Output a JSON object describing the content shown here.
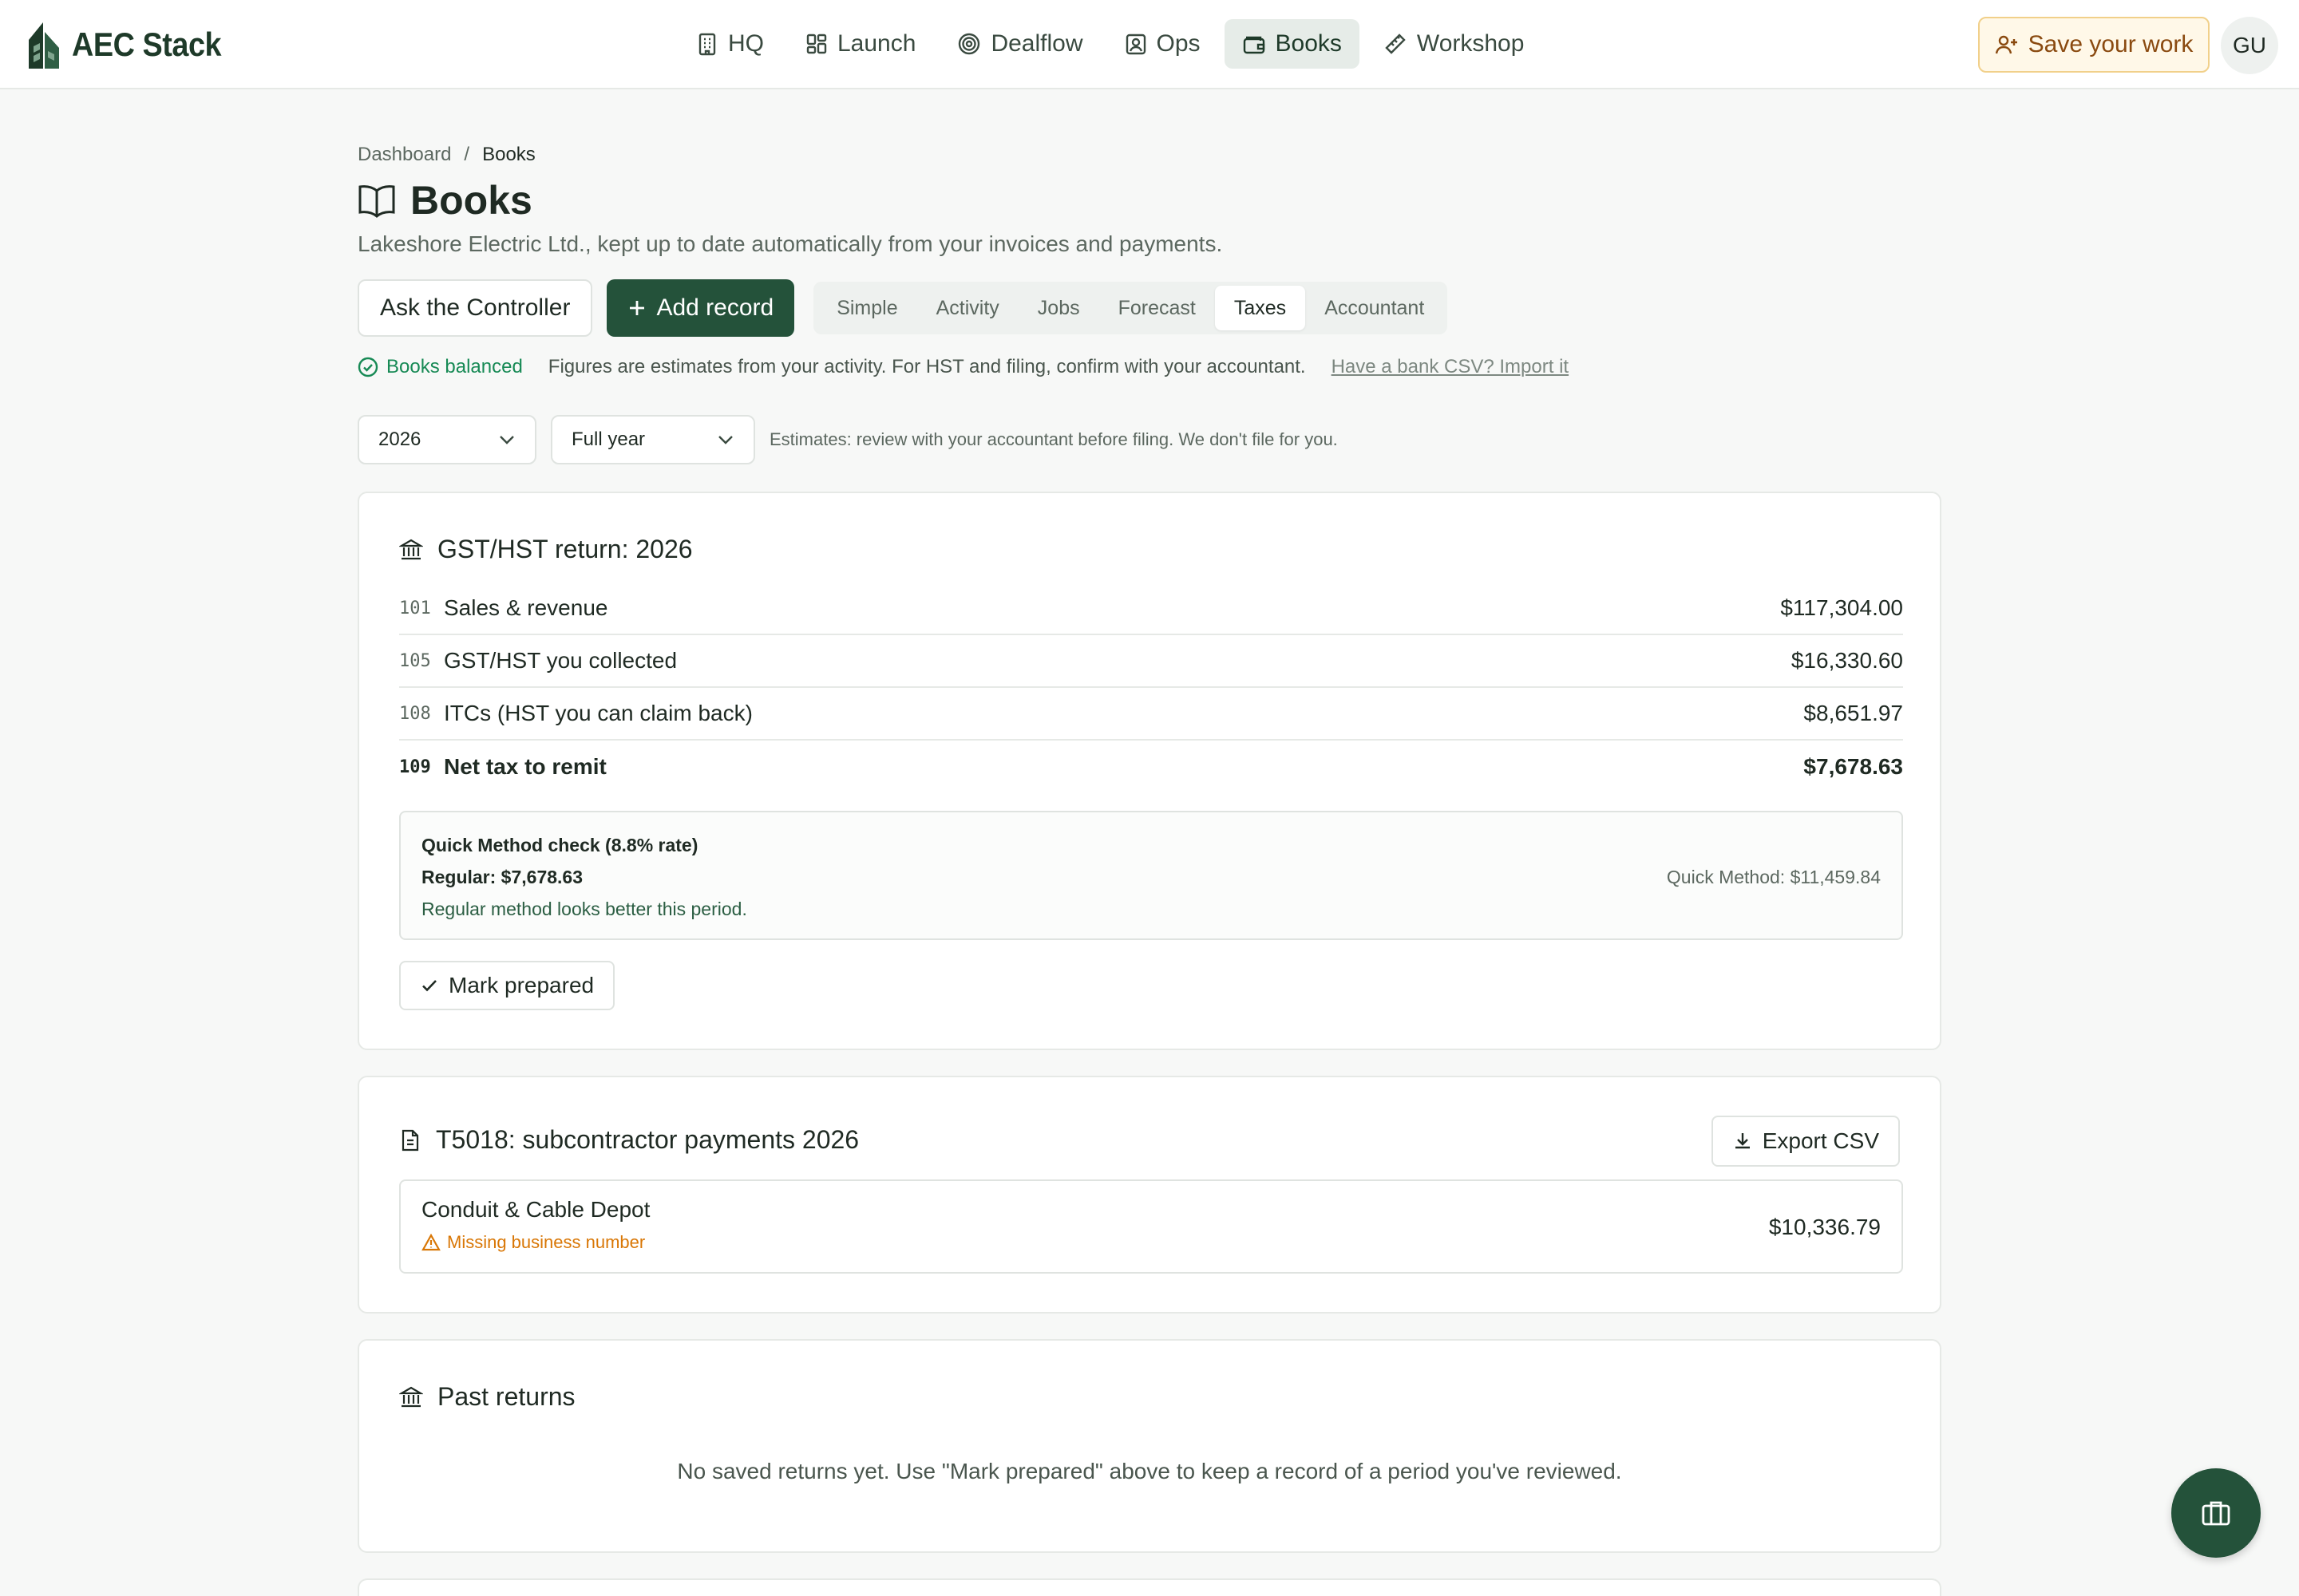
{
  "app": {
    "brand": "AEC Stack"
  },
  "nav": {
    "items": [
      {
        "label": "HQ",
        "icon": "building-icon"
      },
      {
        "label": "Launch",
        "icon": "grid-icon"
      },
      {
        "label": "Dealflow",
        "icon": "target-icon"
      },
      {
        "label": "Ops",
        "icon": "badge-icon"
      },
      {
        "label": "Books",
        "icon": "wallet-icon",
        "active": true
      },
      {
        "label": "Workshop",
        "icon": "ruler-icon"
      }
    ],
    "save_label": "Save your work",
    "avatar_initials": "GU"
  },
  "breadcrumb": {
    "root": "Dashboard",
    "sep": "/",
    "current": "Books"
  },
  "page": {
    "title": "Books",
    "subtitle": "Lakeshore Electric Ltd., kept up to date automatically from your invoices and payments."
  },
  "actions": {
    "ask_label": "Ask the Controller",
    "add_label": "Add record"
  },
  "tabs": [
    {
      "label": "Simple"
    },
    {
      "label": "Activity"
    },
    {
      "label": "Jobs"
    },
    {
      "label": "Forecast"
    },
    {
      "label": "Taxes",
      "active": true
    },
    {
      "label": "Accountant"
    }
  ],
  "status": {
    "balanced": "Books balanced",
    "note": "Figures are estimates from your activity. For HST and filing, confirm with your accountant.",
    "import_link": "Have a bank CSV? Import it"
  },
  "filters": {
    "year": "2026",
    "period": "Full year",
    "note": "Estimates: review with your accountant before filing. We don't file for you."
  },
  "gst": {
    "title": "GST/HST return: 2026",
    "lines": [
      {
        "code": "101",
        "label": "Sales & revenue",
        "value": "$117,304.00"
      },
      {
        "code": "105",
        "label": "GST/HST you collected",
        "value": "$16,330.60"
      },
      {
        "code": "108",
        "label": "ITCs (HST you can claim back)",
        "value": "$8,651.97"
      },
      {
        "code": "109",
        "label": "Net tax to remit",
        "value": "$7,678.63"
      }
    ],
    "quick": {
      "title": "Quick Method check (8.8% rate)",
      "regular": "Regular: $7,678.63",
      "note": "Regular method looks better this period.",
      "quick_value": "Quick Method: $11,459.84"
    },
    "mark_label": "Mark prepared"
  },
  "t5018": {
    "title": "T5018: subcontractor payments 2026",
    "export_label": "Export CSV",
    "vendors": [
      {
        "name": "Conduit & Cable Depot",
        "warning": "Missing business number",
        "amount": "$10,336.79"
      }
    ]
  },
  "past": {
    "title": "Past returns",
    "empty": "No saved returns yet. Use \"Mark prepared\" above to keep a record of a period you've reviewed."
  },
  "colors": {
    "brand": "#24523a",
    "accent_warn": "#d97706",
    "success": "#178a55",
    "save_bg": "#fff8e8"
  }
}
